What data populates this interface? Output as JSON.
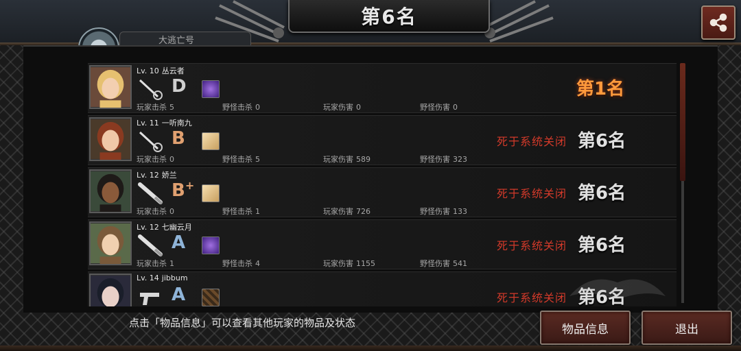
{
  "header": {
    "title": "第6名",
    "subtab_label": "大逃亡号"
  },
  "colors": {
    "first_rank": "#ff9a3c",
    "death_text": "#d43a2a",
    "button_bg": "#4a1f19"
  },
  "stat_labels": {
    "player_kills": "玩家击杀",
    "monster_kills": "野怪击杀",
    "player_damage": "玩家伤害",
    "monster_damage": "野怪伤害"
  },
  "players": [
    {
      "level": "Lv. 10",
      "name": "丛云者",
      "weapon": "sword-icon",
      "grade": "D",
      "grade_plus": "",
      "grade_color": "#cfcfcf",
      "item": "purple-item-icon",
      "player_kills": "5",
      "monster_kills": "0",
      "player_damage": "0",
      "monster_damage": "0",
      "death_reason": "",
      "rank": "第1名"
    },
    {
      "level": "Lv. 11",
      "name": "一听南九",
      "weapon": "sword-icon",
      "grade": "B",
      "grade_plus": "",
      "grade_color": "#e0a070",
      "item": "gold-item-icon",
      "player_kills": "0",
      "monster_kills": "5",
      "player_damage": "589",
      "monster_damage": "323",
      "death_reason": "死于系统关闭",
      "rank": "第6名"
    },
    {
      "level": "Lv. 12",
      "name": "娇兰",
      "weapon": "bat-icon",
      "grade": "B",
      "grade_plus": "+",
      "grade_color": "#e0a070",
      "item": "gold-item-icon",
      "player_kills": "0",
      "monster_kills": "1",
      "player_damage": "726",
      "monster_damage": "133",
      "death_reason": "死于系统关闭",
      "rank": "第6名"
    },
    {
      "level": "Lv. 12",
      "name": "七幽云月",
      "weapon": "bat-icon",
      "grade": "A",
      "grade_plus": "",
      "grade_color": "#8fb4d8",
      "item": "purple-item-icon",
      "player_kills": "1",
      "monster_kills": "4",
      "player_damage": "1155",
      "monster_damage": "541",
      "death_reason": "死于系统关闭",
      "rank": "第6名"
    },
    {
      "level": "Lv. 14",
      "name": "jibbum",
      "weapon": "pistol-icon",
      "grade": "A",
      "grade_plus": "",
      "grade_color": "#8fb4d8",
      "item": "brown-item-icon",
      "player_kills": "",
      "monster_kills": "",
      "player_damage": "",
      "monster_damage": "",
      "death_reason": "死于系统关闭",
      "rank": "第6名"
    }
  ],
  "footer": {
    "hint": "点击「物品信息」可以查看其他玩家的物品及状态",
    "info_button": "物品信息",
    "exit_button": "退出"
  }
}
